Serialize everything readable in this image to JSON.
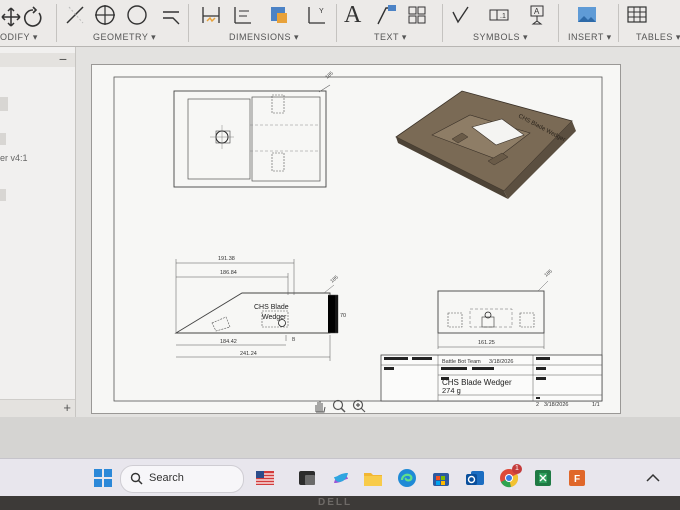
{
  "ribbon": {
    "groups": {
      "modify": "ODIFY ▾",
      "geometry": "GEOMETRY ▾",
      "dimensions": "DIMENSIONS ▾",
      "text": "TEXT ▾",
      "symbols": "SYMBOLS ▾",
      "insert": "INSERT ▾",
      "tables": "TABLES ▾"
    },
    "text_icon_glyph": "A"
  },
  "left_panel": {
    "collapse_glyph": "−",
    "item_label": "er v4:1",
    "add_glyph": "+"
  },
  "drawing": {
    "top_right_callout": "185",
    "dims": {
      "d1": "191.38",
      "d2": "186.84",
      "d3": "184.42",
      "d4": "241.24",
      "height": "70",
      "side_callout": "185",
      "right_width": "161.25",
      "right_callout": "185",
      "front_b": "B"
    },
    "iso_label": "CHS Blade Wedger",
    "front_part_label_1": "CHS Blade",
    "front_part_label_2": "Wedger",
    "title_block": {
      "team": "Battle Bot Team",
      "team_date": "3/18/2026",
      "part_name": "CHS Blade Wedger",
      "mass": "274 g",
      "revision": "2",
      "date": "3/18/2026",
      "sheet": "1/1"
    }
  },
  "taskbar": {
    "search_placeholder": "Search",
    "badge": "1"
  },
  "bezel_brand": "DELL",
  "colors": {
    "ribbon_bg": "#eceae8",
    "sheet_bg": "#f7f7f5",
    "taskbar_bg": "#e8e6ed",
    "part_fill": "#7a6a55"
  }
}
